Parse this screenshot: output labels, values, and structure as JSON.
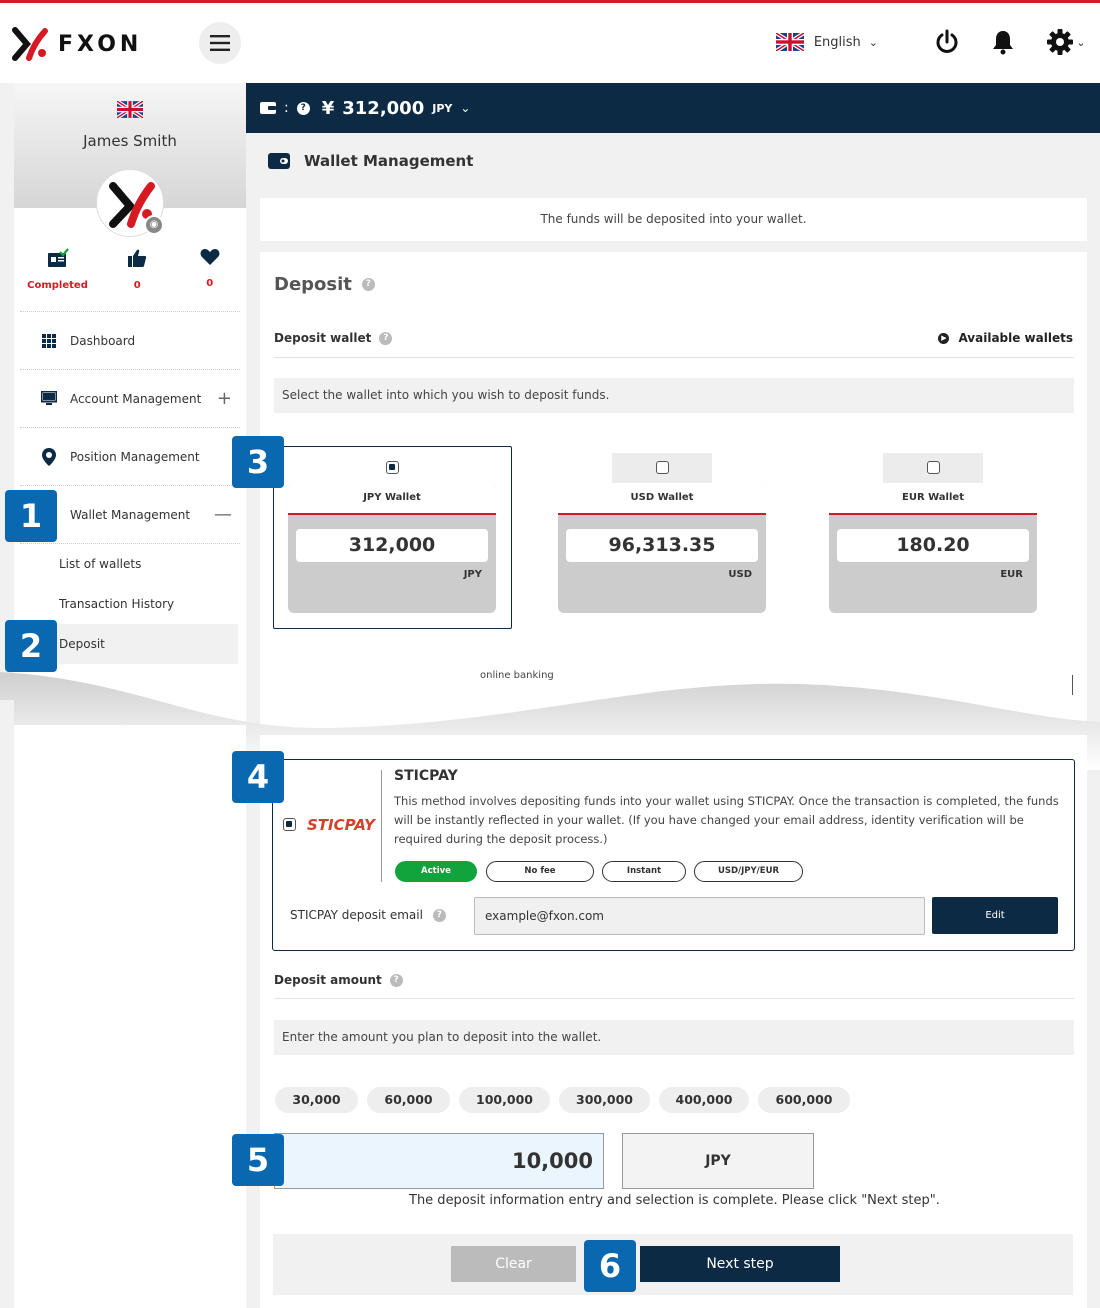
{
  "app": {
    "logo_text": "FXON"
  },
  "header": {
    "language": "English"
  },
  "sidebar": {
    "user_name": "James Smith",
    "stats": [
      {
        "icon": "id-card-check-icon",
        "label": "Completed"
      },
      {
        "icon": "thumbs-up-icon",
        "label": "0"
      },
      {
        "icon": "heart-icon",
        "label": "0"
      }
    ],
    "nav": [
      {
        "label": "Dashboard",
        "icon": "grid-icon"
      },
      {
        "label": "Account Management",
        "icon": "monitor-icon",
        "toggle": "+"
      },
      {
        "label": "Position Management",
        "icon": "location-pin-icon"
      },
      {
        "label": "Wallet Management",
        "icon": "wallet-icon",
        "toggle": "—"
      }
    ],
    "sub_nav": [
      "List of wallets",
      "Transaction History",
      "Deposit"
    ]
  },
  "wallet_bar": {
    "symbol": "¥",
    "amount": "312,000",
    "currency": "JPY",
    "separator": ":"
  },
  "page": {
    "title": "Wallet Management",
    "notice": "The funds will be deposited into your wallet.",
    "deposit_title": "Deposit",
    "deposit_wallet_label": "Deposit wallet",
    "available_wallets": "Available wallets",
    "wallet_hint": "Select the wallet into which you wish to deposit funds.",
    "wallets": [
      {
        "name": "JPY Wallet",
        "value": "312,000",
        "currency": "JPY",
        "selected": true
      },
      {
        "name": "USD Wallet",
        "value": "96,313.35",
        "currency": "USD",
        "selected": false
      },
      {
        "name": "EUR Wallet",
        "value": "180.20",
        "currency": "EUR",
        "selected": false
      }
    ],
    "partial_text": "online banking"
  },
  "sticpay": {
    "logo": "STICPAY",
    "title": "STICPAY",
    "description": "This method involves depositing funds into your wallet using STICPAY. Once the transaction is completed, the funds will be instantly reflected in your wallet. (If you have changed your email address, identity verification will be required during the deposit process.)",
    "tags": [
      "Active",
      "No fee",
      "Instant",
      "USD/JPY/EUR"
    ],
    "email_label": "STICPAY deposit email",
    "email_value": "example@fxon.com",
    "edit_label": "Edit"
  },
  "amount": {
    "label": "Deposit amount",
    "hint": "Enter the amount you plan to deposit into the wallet.",
    "presets": [
      "30,000",
      "60,000",
      "100,000",
      "300,000",
      "400,000",
      "600,000"
    ],
    "value": "10,000",
    "currency": "JPY",
    "complete_msg": "The deposit information entry and selection is complete. Please click \"Next step\".",
    "clear_label": "Clear",
    "next_label": "Next step"
  },
  "badges": [
    "1",
    "2",
    "3",
    "4",
    "5",
    "6"
  ],
  "colors": {
    "navy": "#0d2a45",
    "red": "#d71921",
    "badge_blue": "#0a68b0",
    "active_green": "#12a43c"
  }
}
